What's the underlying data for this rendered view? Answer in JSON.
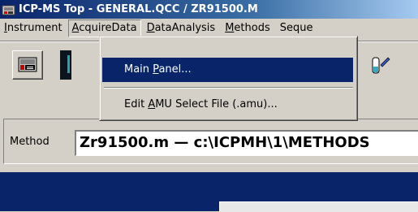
{
  "window": {
    "title": "ICP-MS Top - GENERAL.QCC / ZR91500.M"
  },
  "menubar": {
    "items": [
      {
        "label_u": "I",
        "label_rest": "nstrument"
      },
      {
        "label_u": "A",
        "label_rest": "cquireData"
      },
      {
        "label_u": "D",
        "label_rest": "ataAnalysis"
      },
      {
        "label_u": "M",
        "label_rest": "ethods"
      },
      {
        "label_u": "",
        "label_rest": "Seque"
      }
    ]
  },
  "dropdown": {
    "items": [
      {
        "pre": "Main ",
        "u": "P",
        "post": "anel...",
        "selected": true
      },
      {
        "pre": "Edit ",
        "u": "A",
        "post": "MU Select File (.amu)...",
        "selected": false
      }
    ]
  },
  "method": {
    "label": "Method",
    "value": "Zr91500.m  —  c:\\ICPMH\\1\\METHODS"
  },
  "icons": [
    "app-icon",
    "instrument-icon",
    "sample-tube-icon"
  ],
  "colors": {
    "titlebar": "#0a246a",
    "selection": "#0a246a",
    "face": "#d4d0c8"
  }
}
